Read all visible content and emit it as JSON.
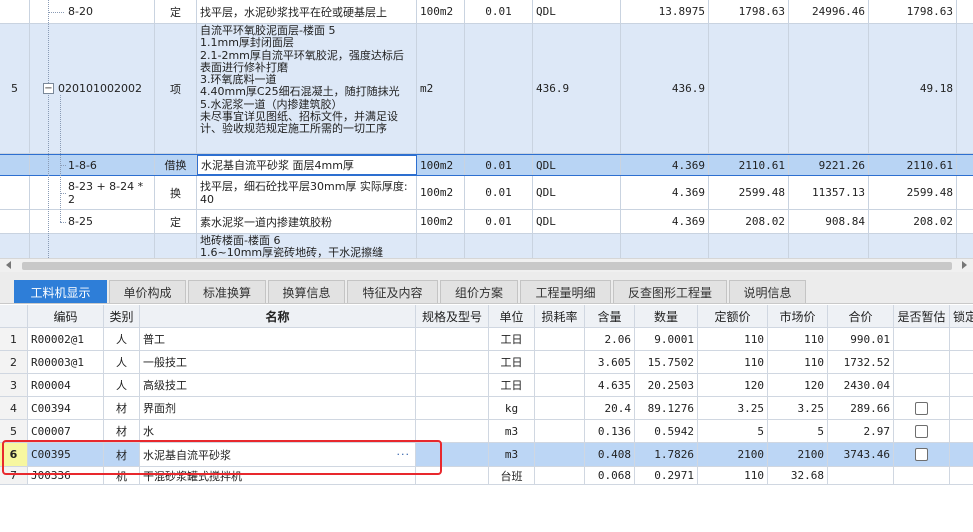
{
  "upper_grid": {
    "rows": [
      {
        "num": "",
        "code": "8-20",
        "type": "定",
        "name": "找平层，水泥砂浆找平在砼或硬基层上",
        "unit": "100m2",
        "coef": "0.01",
        "qty_expr": "QDL",
        "qty": "13.8975",
        "price": "1798.63",
        "total": "24996.46",
        "price2": "1798.63"
      },
      {
        "num": "5",
        "code": "020101002002",
        "type": "项",
        "name_lines": [
          "自流平环氧胶泥面层-楼面 5",
          "1.1mm厚封闭面层",
          "2.1-2mm厚自流平环氧胶泥，强度达标后",
          "表面进行修补打磨",
          "3.环氧底料一道",
          "4.40mm厚C25细石混凝土，随打随抹光",
          "5.水泥浆一道（内掺建筑胶）",
          "未尽事宜详见图纸、招标文件，并满足设",
          "计、验收规范规定施工所需的一切工序"
        ],
        "unit": "m2",
        "coef": "",
        "qty_expr": "436.9",
        "qty": "436.9",
        "price": "",
        "total": "",
        "price2": "49.18"
      },
      {
        "num": "",
        "code": "1-8-6",
        "type": "借换",
        "name": "水泥基自流平砂浆 面层4mm厚",
        "unit": "100m2",
        "coef": "0.01",
        "qty_expr": "QDL",
        "qty": "4.369",
        "price": "2110.61",
        "total": "9221.26",
        "price2": "2110.61"
      },
      {
        "num": "",
        "code_lines": [
          "8-23 + 8-24 *",
          "2"
        ],
        "type": "换",
        "name_lines": [
          "找平层，细石砼找平层30mm厚  实际厚度:",
          "40"
        ],
        "unit": "100m2",
        "coef": "0.01",
        "qty_expr": "QDL",
        "qty": "4.369",
        "price": "2599.48",
        "total": "11357.13",
        "price2": "2599.48"
      },
      {
        "num": "",
        "code": "8-25",
        "type": "定",
        "name": "素水泥浆一道内掺建筑胶粉",
        "unit": "100m2",
        "coef": "0.01",
        "qty_expr": "QDL",
        "qty": "4.369",
        "price": "208.02",
        "total": "908.84",
        "price2": "208.02"
      },
      {
        "num": "",
        "code": "",
        "type": "",
        "name_lines": [
          "地砖楼面-楼面 6",
          "1.6~10mm厚瓷砖地砖，干水泥擦缝"
        ],
        "unit": "",
        "coef": "",
        "qty_expr": "",
        "qty": "",
        "price": "",
        "total": "",
        "price2": ""
      }
    ]
  },
  "tabs": [
    "工料机显示",
    "单价构成",
    "标准换算",
    "换算信息",
    "特征及内容",
    "组价方案",
    "工程量明细",
    "反查图形工程量",
    "说明信息"
  ],
  "lower_grid": {
    "headers": [
      "编码",
      "类别",
      "名称",
      "规格及型号",
      "单位",
      "损耗率",
      "含量",
      "数量",
      "定额价",
      "市场价",
      "合价",
      "是否暂估",
      "锁定"
    ],
    "rows": [
      {
        "num": "1",
        "code": "R00002@1",
        "type": "人",
        "name": "普工",
        "spec": "",
        "unit": "工日",
        "loss": "",
        "content": "2.06",
        "qty": "9.0001",
        "quota": "110",
        "market": "110",
        "total": "990.01",
        "check": false
      },
      {
        "num": "2",
        "code": "R00003@1",
        "type": "人",
        "name": "一般技工",
        "spec": "",
        "unit": "工日",
        "loss": "",
        "content": "3.605",
        "qty": "15.7502",
        "quota": "110",
        "market": "110",
        "total": "1732.52",
        "check": false
      },
      {
        "num": "3",
        "code": "R00004",
        "type": "人",
        "name": "高级技工",
        "spec": "",
        "unit": "工日",
        "loss": "",
        "content": "4.635",
        "qty": "20.2503",
        "quota": "120",
        "market": "120",
        "total": "2430.04",
        "check": false
      },
      {
        "num": "4",
        "code": "C00394",
        "type": "材",
        "name": "界面剂",
        "spec": "",
        "unit": "kg",
        "loss": "",
        "content": "20.4",
        "qty": "89.1276",
        "quota": "3.25",
        "market": "3.25",
        "total": "289.66",
        "check": true
      },
      {
        "num": "5",
        "code": "C00007",
        "type": "材",
        "name": "水",
        "spec": "",
        "unit": "m3",
        "loss": "",
        "content": "0.136",
        "qty": "0.5942",
        "quota": "5",
        "market": "5",
        "total": "2.97",
        "check": true
      },
      {
        "num": "6",
        "code": "C00395",
        "type": "材",
        "name": "水泥基自流平砂浆",
        "spec": "",
        "unit": "m3",
        "loss": "",
        "content": "0.408",
        "qty": "1.7826",
        "quota": "2100",
        "market": "2100",
        "total": "3743.46",
        "check": true
      },
      {
        "num": "7",
        "code": "J00336",
        "type": "机",
        "name": "干混砂浆罐式搅拌机",
        "spec": "",
        "unit": "台班",
        "loss": "",
        "content": "0.068",
        "qty": "0.2971",
        "quota": "110",
        "market": "32.68",
        "total": "",
        "check": false
      }
    ],
    "selected_row": "6",
    "edit_dots": "···"
  },
  "colors": {
    "tab_active": "#2e7ed8",
    "selection": "#b8d4f4",
    "highlight_box": "#e8282d"
  }
}
